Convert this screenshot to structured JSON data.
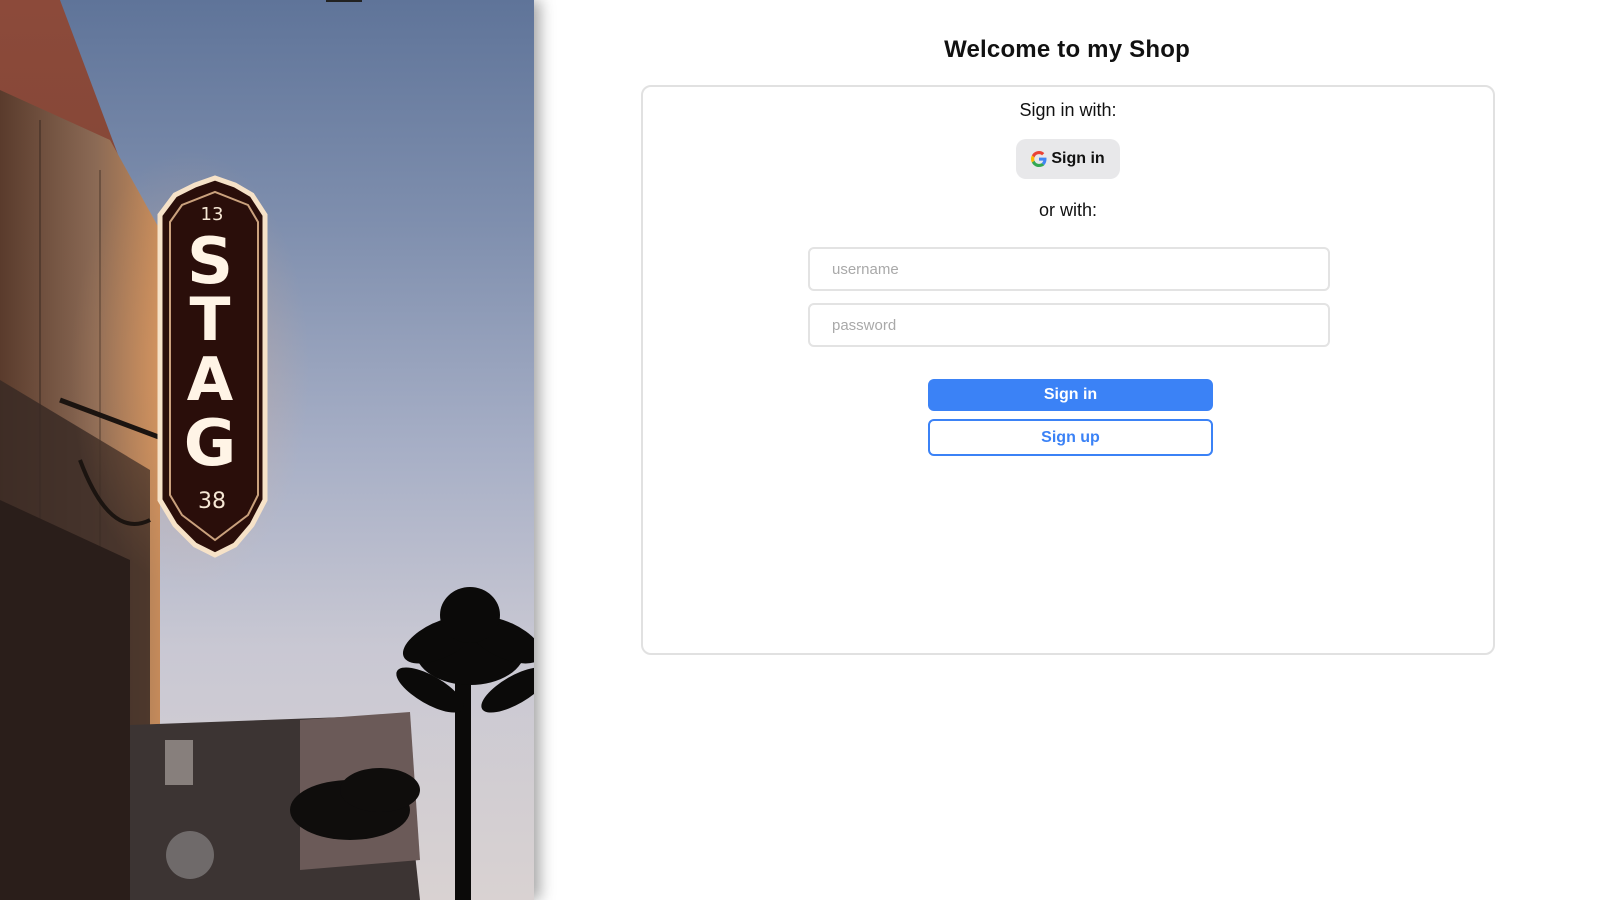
{
  "hero": {
    "sign_top_number": "13",
    "sign_letters": [
      "S",
      "T",
      "A",
      "G"
    ],
    "sign_bottom_number": "38"
  },
  "header": {
    "title": "Welcome to my Shop"
  },
  "login": {
    "sign_in_with_label": "Sign in with:",
    "google_button_label": "Sign in",
    "google_icon": "google-g-icon",
    "or_with_label": "or with:",
    "username_placeholder": "username",
    "username_value": "",
    "password_placeholder": "password",
    "password_value": "",
    "sign_in_button_label": "Sign in",
    "sign_up_button_label": "Sign up"
  },
  "colors": {
    "primary": "#3b82f6",
    "google_button_bg": "#e8e8ea",
    "card_border": "#e1e1e1"
  }
}
